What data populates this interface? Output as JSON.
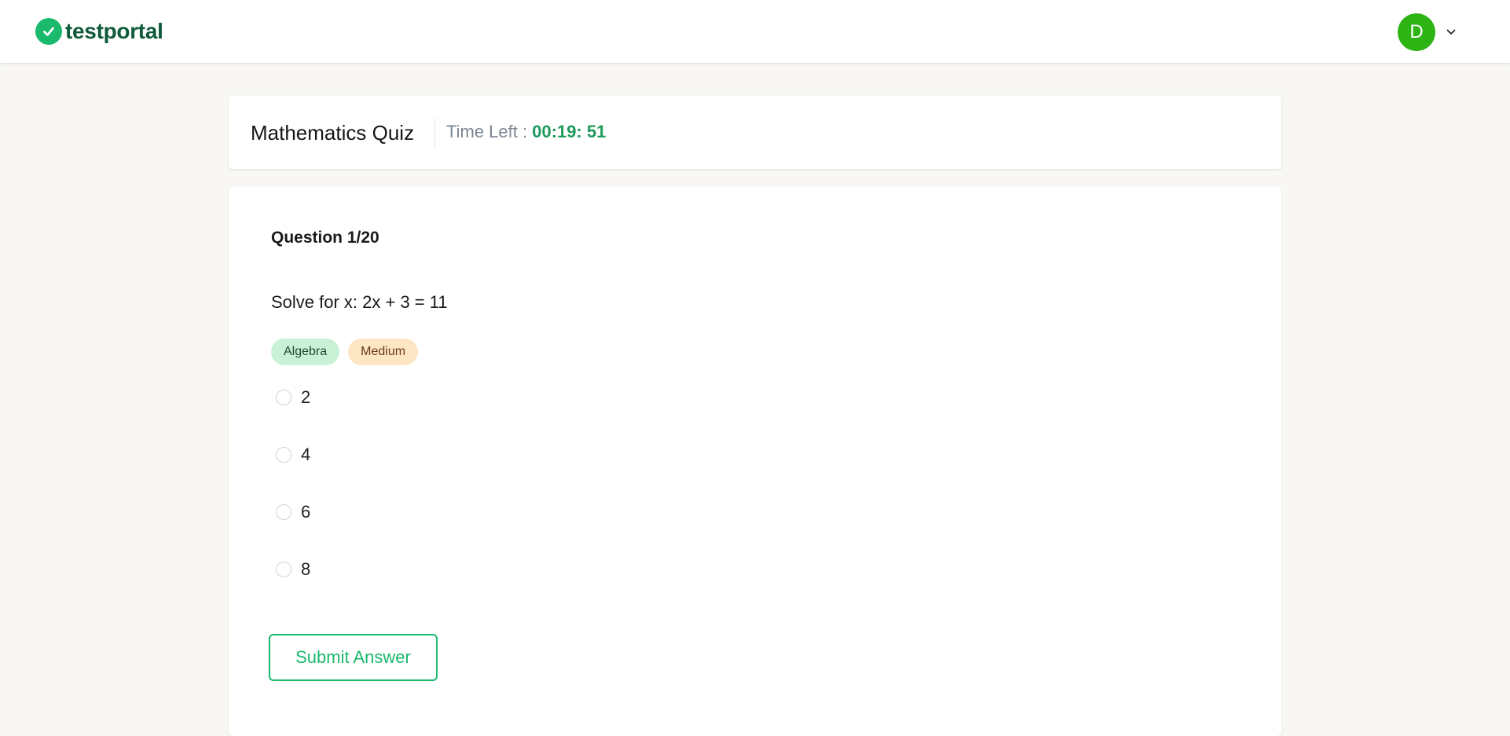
{
  "brand": {
    "name": "testportal",
    "color": "#1bb96c",
    "logo_icon": "check-circle-icon"
  },
  "user": {
    "initial": "D",
    "avatar_color": "#2db414",
    "menu_icon": "chevron-down-icon"
  },
  "quiz": {
    "title": "Mathematics Quiz",
    "time_left_label": "Time Left :",
    "time_left_value": "00:19: 51"
  },
  "question": {
    "counter": "Question 1/20",
    "text": "Solve for x: 2x + 3 = 11",
    "tags": [
      {
        "label": "Algebra",
        "color": "#c9f1d6"
      },
      {
        "label": "Medium",
        "color": "#fde6c4"
      }
    ],
    "options": [
      {
        "label": "2",
        "selected": false
      },
      {
        "label": "4",
        "selected": false
      },
      {
        "label": "6",
        "selected": false
      },
      {
        "label": "8",
        "selected": false
      }
    ],
    "submit_label": "Submit Answer"
  }
}
